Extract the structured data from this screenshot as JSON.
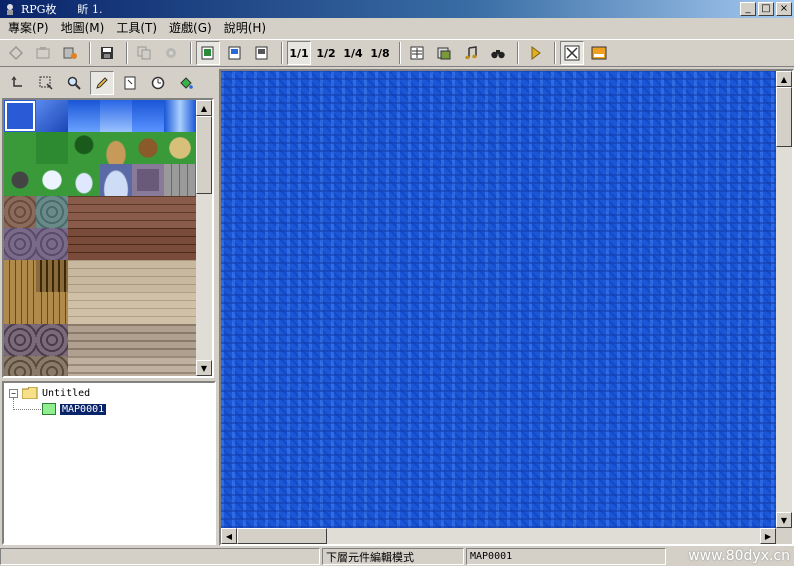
{
  "window": {
    "title": "RPG枚      盺 1.",
    "minimize": "_",
    "maximize": "□",
    "close": "×"
  },
  "menu": {
    "items": [
      {
        "label": "專案(P)"
      },
      {
        "label": "地圖(M)"
      },
      {
        "label": "工具(T)"
      },
      {
        "label": "遊戲(G)"
      },
      {
        "label": "說明(H)"
      }
    ]
  },
  "toolbar": {
    "scale_1_1": "1/1",
    "scale_1_2": "1/2",
    "scale_1_4": "1/4",
    "scale_1_8": "1/8"
  },
  "tree": {
    "root_label": "Untitled",
    "map_label": "MAP0001",
    "expander": "−"
  },
  "status": {
    "mode_text": "下層元件編輯模式",
    "map_name": "MAP0001"
  },
  "watermark": "www.80dyx.cn",
  "colors": {
    "water": "#1a56d6",
    "title_bar": "#0a246a",
    "window_face": "#d4d0c8"
  }
}
